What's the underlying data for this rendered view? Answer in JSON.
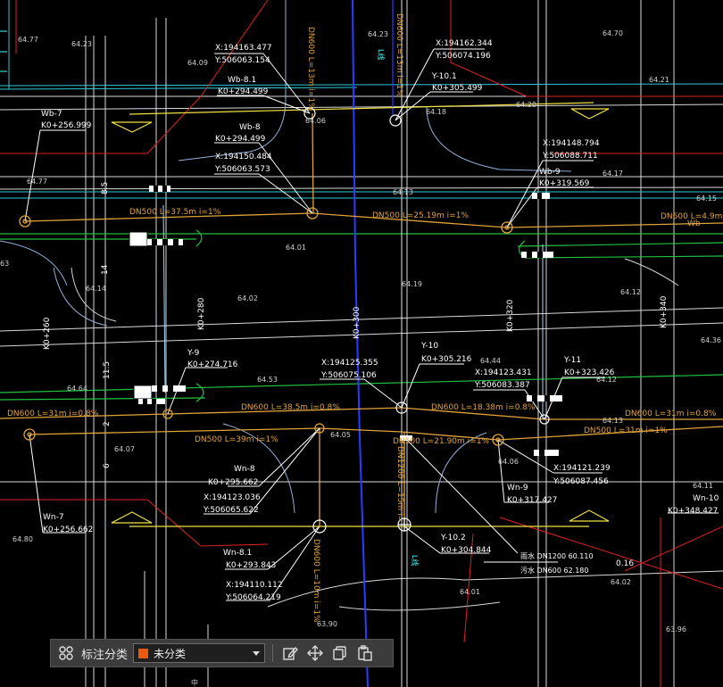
{
  "toolbar": {
    "category_label": "标注分类",
    "selected_category": "未分类",
    "swatch_color": "#e85a10",
    "icons": [
      "grid-icon",
      "edit-icon",
      "move-icon",
      "copy-icon",
      "paste-icon"
    ]
  },
  "drawing": {
    "nodes": {
      "top_left_coord_x": "X:194163.477",
      "top_left_coord_y": "Y:506063.154",
      "wb81_name": "Wb-8.1",
      "wb81_k": "K0+294.499",
      "wb8_name": "Wb-8",
      "wb8_k": "K0+294.499",
      "wb8_x": "X:194150.484",
      "wb8_y": "Y:506063.573",
      "wb7_name": "Wb-7",
      "wb7_k": "K0+256.999",
      "top_right_coord_x": "X:194162.344",
      "top_right_coord_y": "Y:506074.196",
      "y101_name": "Y-10.1",
      "y101_k": "K0+305.499",
      "wb9_x": "X:194148.794",
      "wb9_y": "Y:506088.711",
      "wb9_name": "Wb-9",
      "wb9_k": "K0+319.569",
      "y9_name": "Y-9",
      "y9_k": "K0+274.716",
      "y10_name": "Y-10",
      "y10_k": "K0+305.216",
      "y10_x": "X:194125.355",
      "y10_y": "Y:506075.106",
      "y11_x": "X:194123.431",
      "y11_y": "Y:506083.387",
      "y11_name": "Y-11",
      "y11_k": "K0+323.426",
      "wn8_name": "Wn-8",
      "wn8_k": "K0+295.662",
      "wn8_x": "X:194123.036",
      "wn8_y": "Y:506065.622",
      "wn7_name": "Wn-7",
      "wn7_k": "K0+256.662",
      "wn81_name": "Wn-8.1",
      "wn81_k": "K0+293.843",
      "wn81_x": "X:194110.112",
      "wn81_y": "Y:506064.219",
      "y102_name": "Y-10.2",
      "y102_k": "K0+304.844",
      "wn9_x": "X:194121.239",
      "wn9_y": "Y:506087.456",
      "wn9_name": "Wn-9",
      "wn9_k": "K0+317.427",
      "wn10_name": "Wn-10",
      "wn10_k": "K0+348.427"
    },
    "pipes": {
      "dn600_v_top_left": "DN600 L=13m i=1%",
      "dn600_v_top_right": "DN600 L=13m i=1%",
      "dn500_l375": "DN500 L=37.5m i=1%",
      "dn500_l2519": "DN500 L=25.19m i=1%",
      "dn600_right_top": "DN600 L=4.9m i=",
      "wb_right": "Wb",
      "dn600_left_31": "DN600 L=31m i=0.8%",
      "dn600_l385": "DN600 L=38.5m i=0.8%",
      "dn600_l1838": "DN600 L=18.38m i=0.8%",
      "dn600_right_31": "DN600 L=31m i=0.8%",
      "dn500_l39": "DN500 L=39m i=1%",
      "dn500_l2190": "DN500 L=21.90m i=1%",
      "dn500_right_31": "DN500 L=31m i=1%",
      "dn1200": "DN1200 L=15m i=",
      "dn600_bottom": "DN600 L=10m i=1%"
    },
    "stations": {
      "k0_260": "K0+260",
      "k0_280": "K0+280",
      "k0_300": "K0+300",
      "k0_320": "K0+320",
      "k0_340": "K0+340"
    },
    "dims": {
      "d85": "8.5",
      "d14": "14",
      "d115": "11.5",
      "d2": "2",
      "d6": "6"
    },
    "elevations": [
      "64.23",
      "64.23",
      "64.09",
      "64.18",
      "64.06",
      "64.20",
      "64.21",
      "64.17",
      "64.13",
      "64.15",
      "64.01",
      "64.19",
      "64.02",
      "64.12",
      "64.14",
      "64.53",
      "64.44",
      "64.36",
      "64.64",
      "64.05",
      "64.06",
      "64.07",
      "64.13",
      "64.11",
      "64.80",
      "64.01",
      "64.02",
      "63.96",
      "63.90",
      "64.77",
      "64.77",
      "64.70",
      "63",
      "64.12"
    ],
    "legend": {
      "rain_label": "雨水 DN1200 60.110",
      "sewer_label": "污水 DN600 62.180",
      "diff": "0.16"
    },
    "misc_text": {
      "ls": "L线",
      "bottom_zhong": "中"
    }
  }
}
